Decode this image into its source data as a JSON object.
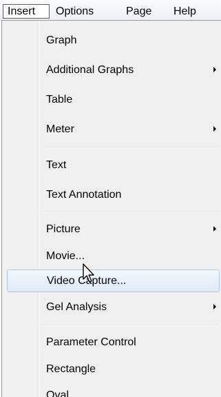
{
  "menubar": {
    "items": [
      {
        "label": "Insert",
        "active": true
      },
      {
        "label": "Options"
      },
      {
        "label": "Page"
      },
      {
        "label": "Help"
      }
    ]
  },
  "dropdown": {
    "items": [
      {
        "label": "Graph",
        "has_submenu": false
      },
      {
        "label": "Additional Graphs",
        "has_submenu": true
      },
      {
        "label": "Table",
        "has_submenu": false
      },
      {
        "label": "Meter",
        "has_submenu": true
      },
      {
        "label": "Text",
        "has_submenu": false
      },
      {
        "label": "Text Annotation",
        "has_submenu": false
      },
      {
        "label": "Picture",
        "has_submenu": true
      },
      {
        "label": "Movie...",
        "has_submenu": false
      },
      {
        "label": "Video Capture...",
        "has_submenu": false,
        "highlighted": true
      },
      {
        "label": "Gel Analysis",
        "has_submenu": true
      },
      {
        "label": "Parameter Control",
        "has_submenu": false
      },
      {
        "label": "Rectangle",
        "has_submenu": false
      },
      {
        "label": "Oval",
        "has_submenu": false
      }
    ]
  },
  "colors": {
    "highlight_border": "#a8c7ec",
    "highlight_fill": "#dfeaf8",
    "menu_background": "#f0f0f0"
  },
  "icons": {
    "submenu": "chevron-right-icon",
    "cursor": "mouse-pointer-icon"
  }
}
